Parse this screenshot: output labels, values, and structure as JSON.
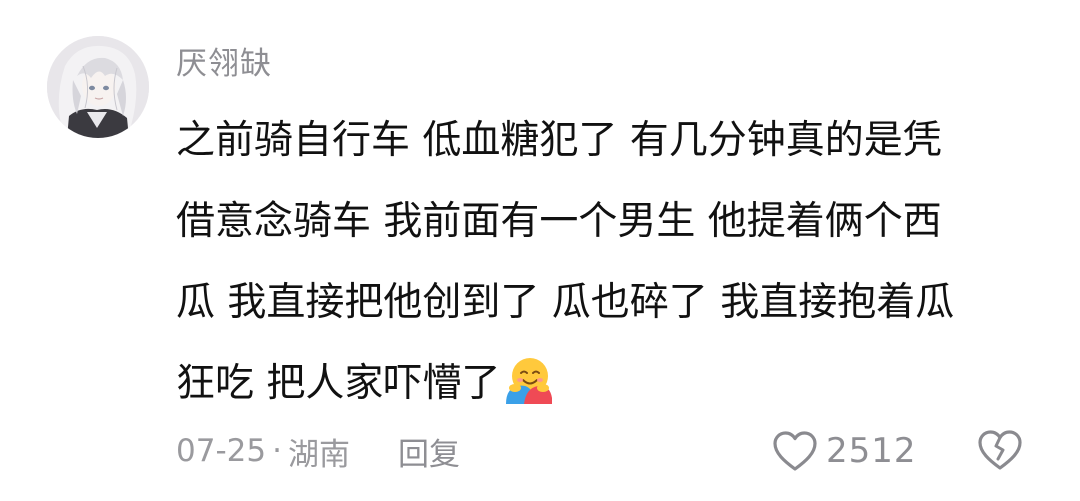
{
  "comment": {
    "username": "厌翎缺",
    "avatar_icon": "anime-girl-avatar",
    "text_lines": [
      "之前骑自行车 低血糖犯了 有几分钟真的是凭",
      "借意念骑车 我前面有一个男生 他提着俩个西",
      "瓜 我直接把他创到了 瓜也碎了 我直接抱着瓜",
      "狂吃 把人家吓懵了"
    ],
    "emoji_icon": "hugging-face-emoji",
    "date": "07-25",
    "separator": "·",
    "location": "湖南",
    "reply_label": "回复",
    "like_icon": "heart-outline-icon",
    "like_count": "2512",
    "dislike_icon": "broken-heart-outline-icon",
    "colors": {
      "text": "#111111",
      "meta": "#8e8e93",
      "icon": "#8a8a8f",
      "background": "#ffffff"
    }
  }
}
